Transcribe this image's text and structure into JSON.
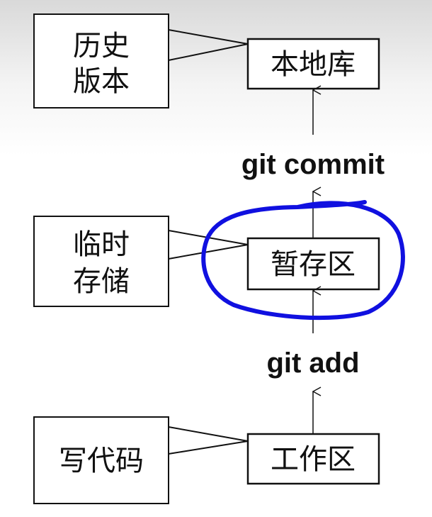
{
  "nodes": {
    "local_repo": "本地库",
    "staging": "暂存区",
    "workspace": "工作区"
  },
  "notes": {
    "history": [
      "历史",
      "版本"
    ],
    "temp": [
      "临时",
      "存储"
    ],
    "code": "写代码"
  },
  "commands": {
    "commit": "git commit",
    "add": "git add"
  },
  "colors": {
    "highlight": "#1010e0"
  }
}
